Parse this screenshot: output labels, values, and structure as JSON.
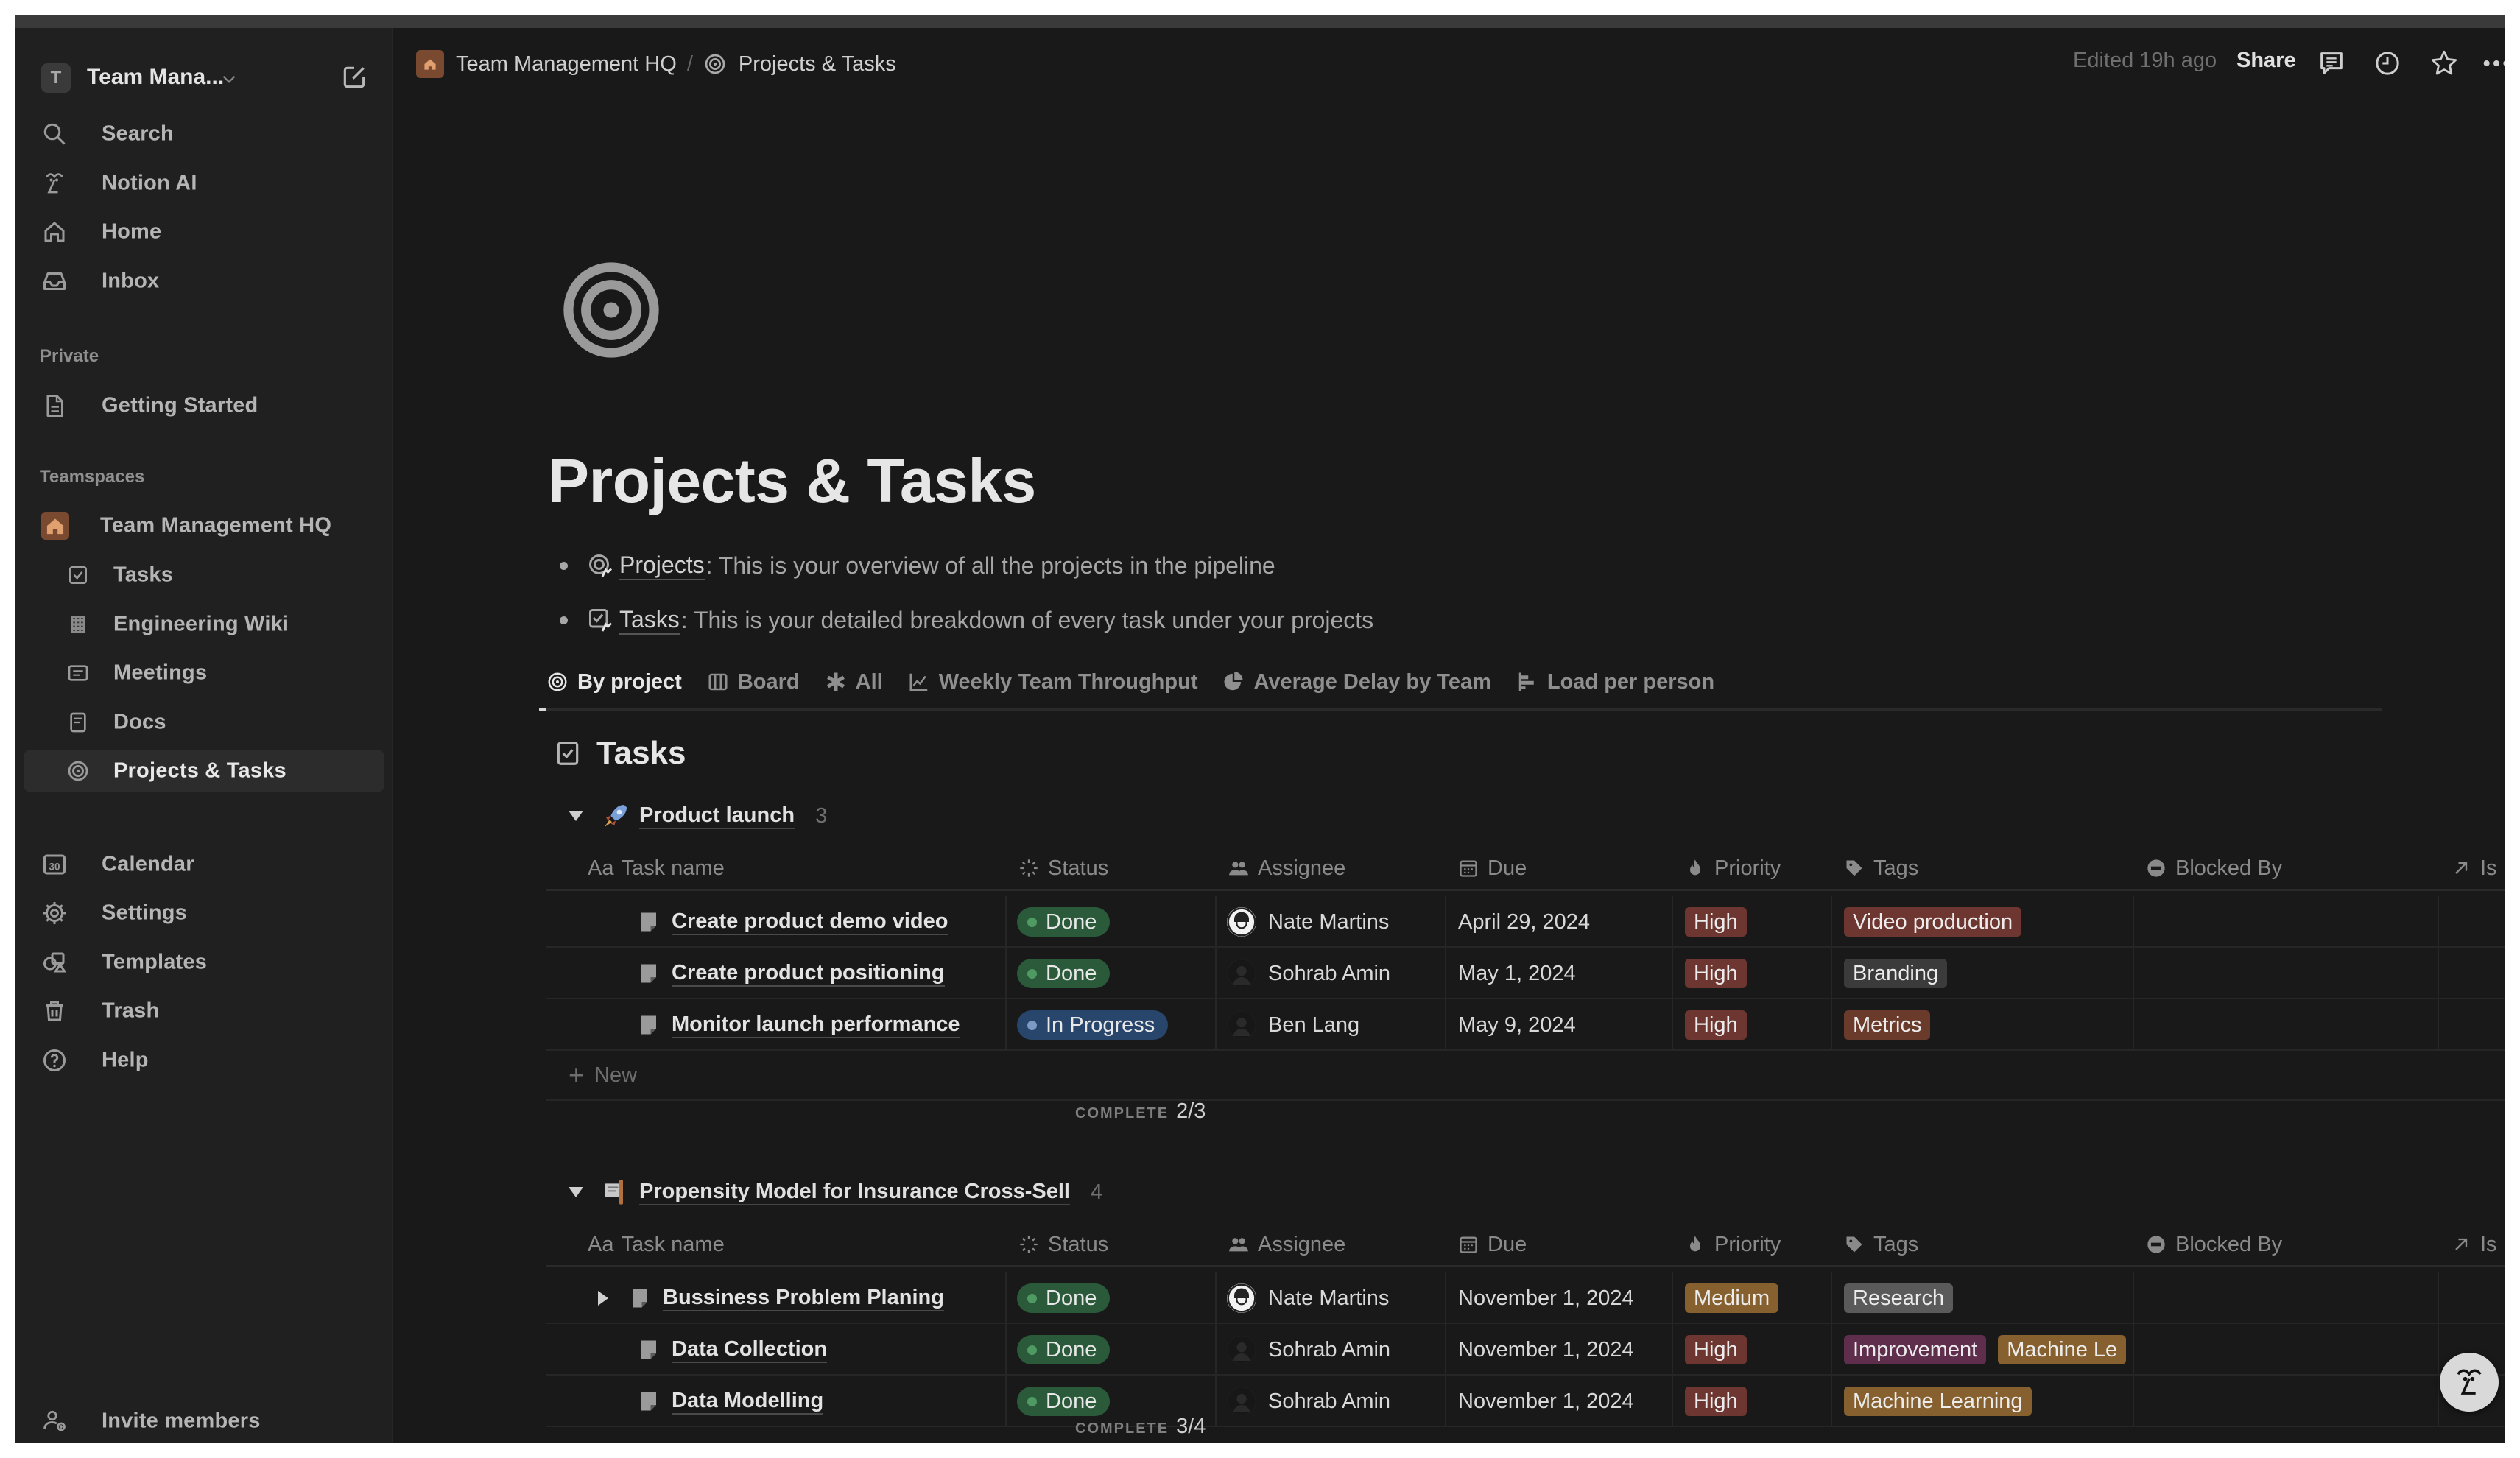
{
  "sidebar": {
    "workspace": {
      "badge": "T",
      "name": "Team Mana..."
    },
    "top_items": [
      {
        "label": "Search",
        "icon": "search-icon"
      },
      {
        "label": "Notion AI",
        "icon": "notion-ai-icon"
      },
      {
        "label": "Home",
        "icon": "home-icon"
      },
      {
        "label": "Inbox",
        "icon": "inbox-icon"
      }
    ],
    "private_label": "Private",
    "private_items": [
      {
        "label": "Getting Started",
        "icon": "page-icon"
      }
    ],
    "teamspaces_label": "Teamspaces",
    "teamspace": {
      "label": "Team Management HQ",
      "icon": "house-icon"
    },
    "teamspace_items": [
      {
        "label": "Tasks",
        "icon": "checkbox-icon"
      },
      {
        "label": "Engineering Wiki",
        "icon": "wiki-icon"
      },
      {
        "label": "Meetings",
        "icon": "meetings-icon"
      },
      {
        "label": "Docs",
        "icon": "doc-icon"
      },
      {
        "label": "Projects & Tasks",
        "icon": "target-icon",
        "active": true
      }
    ],
    "bottom_items": [
      {
        "label": "Calendar",
        "icon": "calendar-icon"
      },
      {
        "label": "Settings",
        "icon": "gear-icon"
      },
      {
        "label": "Templates",
        "icon": "templates-icon"
      },
      {
        "label": "Trash",
        "icon": "trash-icon"
      },
      {
        "label": "Help",
        "icon": "help-icon"
      }
    ],
    "invite_label": "Invite members"
  },
  "topbar": {
    "breadcrumb": [
      "Team Management HQ",
      "Projects & Tasks"
    ],
    "separator": "/",
    "edited": "Edited 19h ago",
    "share_label": "Share"
  },
  "page": {
    "title": "Projects & Tasks",
    "bullets": [
      {
        "link": "Projects",
        "text": ": This is your overview of all the projects in the pipeline"
      },
      {
        "link": "Tasks",
        "text": ": This is your detailed breakdown of every task under your projects"
      }
    ],
    "tabs": [
      {
        "label": "By project",
        "icon": "target-icon",
        "active": true
      },
      {
        "label": "Board",
        "icon": "board-icon"
      },
      {
        "label": "All",
        "icon": "asterisk-icon"
      },
      {
        "label": "Weekly Team Throughput",
        "icon": "line-chart-icon"
      },
      {
        "label": "Average Delay by Team",
        "icon": "pie-chart-icon"
      },
      {
        "label": "Load per person",
        "icon": "bar-chart-icon"
      }
    ],
    "database_title": "Tasks"
  },
  "table": {
    "columns": [
      "Task name",
      "Status",
      "Assignee",
      "Due",
      "Priority",
      "Tags",
      "Blocked By",
      "Is"
    ],
    "column_prefix_taskname": "Aa",
    "new_label": "New",
    "complete_label": "COMPLETE"
  },
  "colors": {
    "status_done_bg": "#2b5a3a",
    "status_done_dot": "#4f9a63",
    "status_inprogress_bg": "#28456c",
    "status_inprogress_dot": "#7c9ac4",
    "priority_high": "#6e3630",
    "priority_medium": "#87602f",
    "tag_video_production": "#6e3630",
    "tag_branding": "#3b3b3b",
    "tag_metrics": "#6a3b2b",
    "tag_research": "#5a5a5a",
    "tag_improvement": "#5e2e4c",
    "tag_machine_learning": "#87602f"
  },
  "groups": [
    {
      "name": "Product launch",
      "count": "3",
      "complete": "2/3",
      "rows": [
        {
          "task": "Create product demo video",
          "status": "Done",
          "assignee": "Nate Martins",
          "due": "April 29, 2024",
          "priority": "High",
          "tags": [
            "Video production"
          ]
        },
        {
          "task": "Create product positioning",
          "status": "Done",
          "assignee": "Sohrab Amin",
          "due": "May 1, 2024",
          "priority": "High",
          "tags": [
            "Branding"
          ]
        },
        {
          "task": "Monitor launch performance",
          "status": "In Progress",
          "assignee": "Ben Lang",
          "due": "May 9, 2024",
          "priority": "High",
          "tags": [
            "Metrics"
          ]
        }
      ]
    },
    {
      "name": "Propensity Model for Insurance Cross-Sell",
      "count": "4",
      "complete": "3/4",
      "rows": [
        {
          "task": "Bussiness Problem Planing",
          "status": "Done",
          "assignee": "Nate Martins",
          "due": "November 1, 2024",
          "priority": "Medium",
          "tags": [
            "Research"
          ],
          "expandable": true
        },
        {
          "task": "Data Collection",
          "status": "Done",
          "assignee": "Sohrab Amin",
          "due": "November 1, 2024",
          "priority": "High",
          "tags": [
            "Improvement",
            "Machine Le"
          ]
        },
        {
          "task": "Data Modelling",
          "status": "Done",
          "assignee": "Sohrab Amin",
          "due": "November 1, 2024",
          "priority": "High",
          "tags": [
            "Machine Learning"
          ]
        }
      ]
    }
  ]
}
